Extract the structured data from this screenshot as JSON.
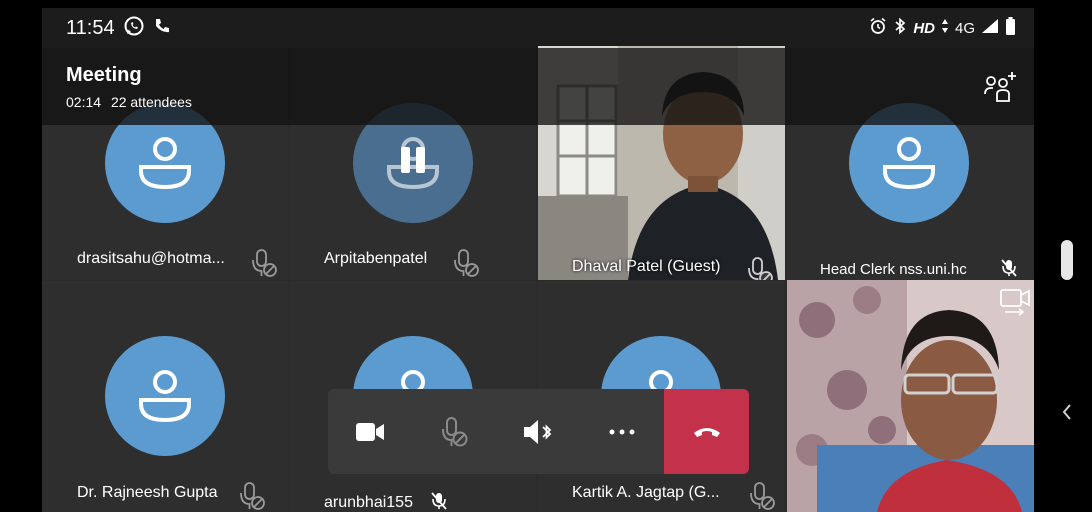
{
  "status_bar": {
    "time": "11:54",
    "hd_label": "HD",
    "network_label": "4G"
  },
  "header": {
    "title": "Meeting",
    "duration": "02:14",
    "attendees": "22 attendees"
  },
  "participants": [
    {
      "name": "drasitsahu@hotma..."
    },
    {
      "name": "Arpitabenpatel"
    },
    {
      "name": "Dhaval Patel (Guest)"
    },
    {
      "name": "Head Clerk  nss.uni.hc"
    },
    {
      "name": "Dr. Rajneesh Gupta"
    },
    {
      "name": "arunbhai155"
    },
    {
      "name": "Kartik A. Jagtap (G..."
    }
  ],
  "colors": {
    "avatar": "#5b9bd0",
    "avatar_dim": "#4a6e8f",
    "tile": "#2e2e2e",
    "end_call": "#c4314b",
    "controls_bar": "#3a3a3a"
  }
}
